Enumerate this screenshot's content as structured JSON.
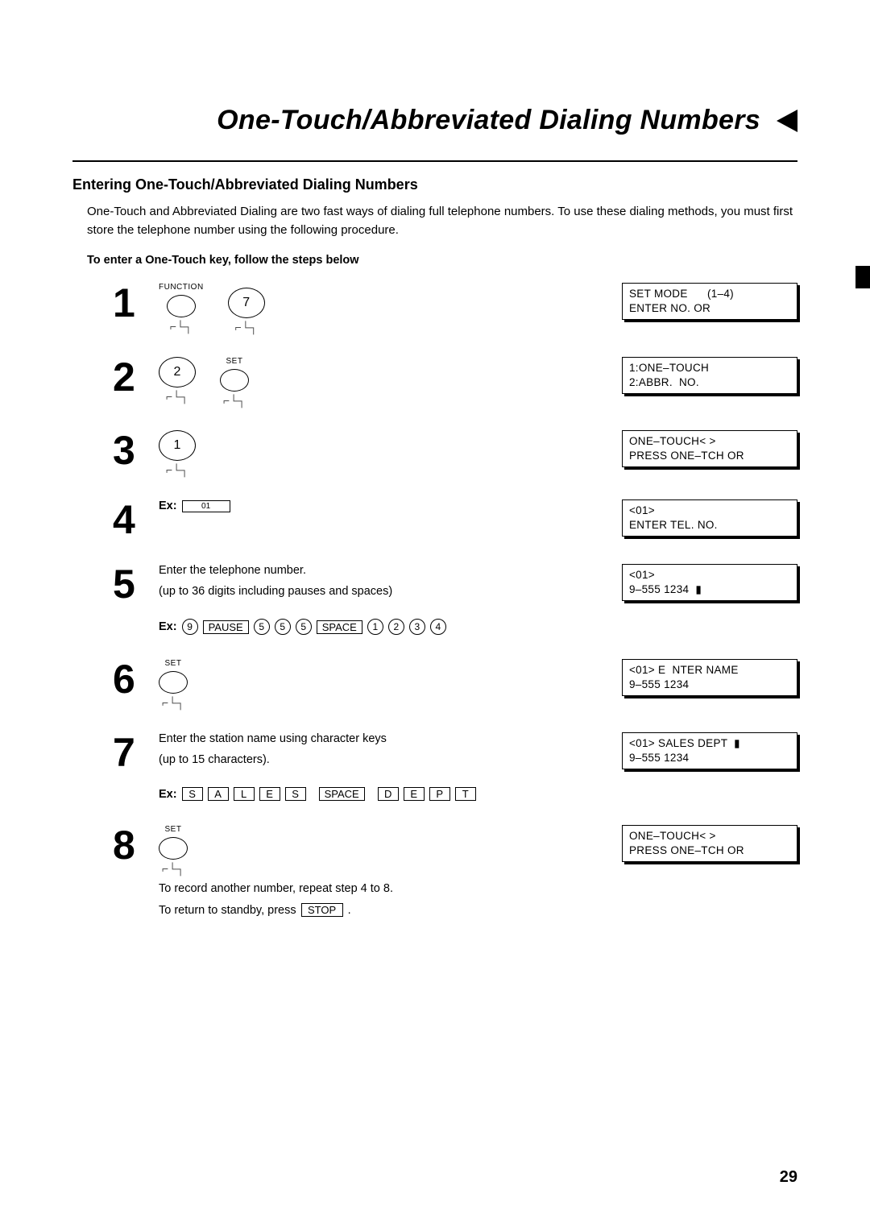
{
  "title": "One-Touch/Abbreviated Dialing Numbers",
  "subhead": "Entering One-Touch/Abbreviated Dialing Numbers",
  "intro": "One-Touch and Abbreviated Dialing are two fast ways of dialing full telephone numbers.  To use these dialing methods, you must first store the telephone number using the following procedure.",
  "subsub": "To enter a One-Touch key, follow the steps below",
  "labels": {
    "function": "FUNCTION",
    "set": "SET",
    "ex": "Ex:",
    "pause": "PAUSE",
    "space": "SPACE",
    "stop": "STOP"
  },
  "steps": {
    "s1": {
      "no": "1",
      "num_key": "7",
      "lcd": "SET MODE      (1–4)\nENTER NO. OR"
    },
    "s2": {
      "no": "2",
      "num_key": "2",
      "lcd": "1:ONE–TOUCH\n2:ABBR.  NO."
    },
    "s3": {
      "no": "3",
      "num_key": "1",
      "lcd": "ONE–TOUCH< >\nPRESS ONE–TCH OR"
    },
    "s4": {
      "no": "4",
      "key_small": "01",
      "lcd": "<01>\nENTER TEL. NO."
    },
    "s5": {
      "no": "5",
      "text1": "Enter the telephone number.",
      "text2": "(up to 36 digits including pauses and spaces)",
      "ex_digits_a": [
        "9"
      ],
      "ex_digits_b": [
        "5",
        "5",
        "5"
      ],
      "ex_digits_c": [
        "1",
        "2",
        "3",
        "4"
      ],
      "lcd": "<01>\n9–555 1234  ▮"
    },
    "s6": {
      "no": "6",
      "lcd": "<01> E  NTER NAME\n9–555 1234"
    },
    "s7": {
      "no": "7",
      "text1": "Enter the station name using character keys",
      "text2": "(up to 15 characters).",
      "ex_chars_a": [
        "S",
        "A",
        "L",
        "E",
        "S"
      ],
      "ex_chars_b": [
        "D",
        "E",
        "P",
        "T"
      ],
      "lcd": "<01> SALES DEPT  ▮\n9–555 1234"
    },
    "s8": {
      "no": "8",
      "note1": "To record another number, repeat step 4 to 8.",
      "note2a": "To return to standby, press  ",
      "note2b": " .",
      "lcd": "ONE–TOUCH< >\nPRESS ONE–TCH OR"
    }
  },
  "page_number": "29"
}
